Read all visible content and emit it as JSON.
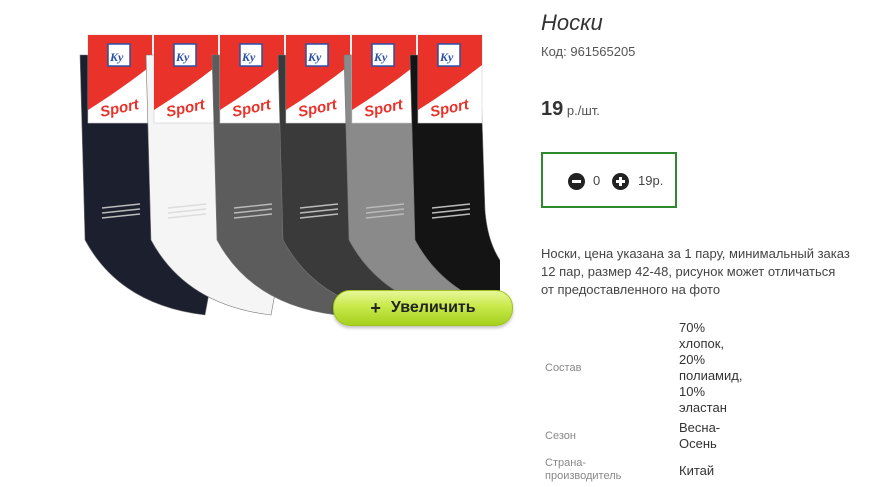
{
  "product": {
    "title": "Носки",
    "code_label": "Код:",
    "code": "961565205",
    "price_value": "19",
    "price_unit": "р./шт.",
    "description": "Носки, цена указана за 1 пару, минимальный заказ 12 пар, размер 42-48, рисунок может отличаться от предоставленного на фото"
  },
  "image": {
    "tag_brand": "Ky",
    "sock_text": "Sport",
    "zoom_plus": "+",
    "zoom_label": "Увеличить",
    "sock_colors": [
      "#1b1f2e",
      "#f5f5f5",
      "#5c5c5c",
      "#3a3a3a",
      "#8a8a8a",
      "#141414"
    ]
  },
  "cart": {
    "quantity": "0",
    "total": "19р.",
    "border_color": "#2f8a2f"
  },
  "specs": [
    {
      "label": "Состав",
      "value_lines": [
        "70%",
        "хлопок,",
        "20%",
        "полиамид,",
        "10%",
        "эластан"
      ]
    },
    {
      "label": "Сезон",
      "value_lines": [
        "Весна-",
        "Осень"
      ]
    },
    {
      "label_lines": [
        "Страна-",
        "производитель"
      ],
      "value_lines": [
        "Китай"
      ]
    }
  ]
}
